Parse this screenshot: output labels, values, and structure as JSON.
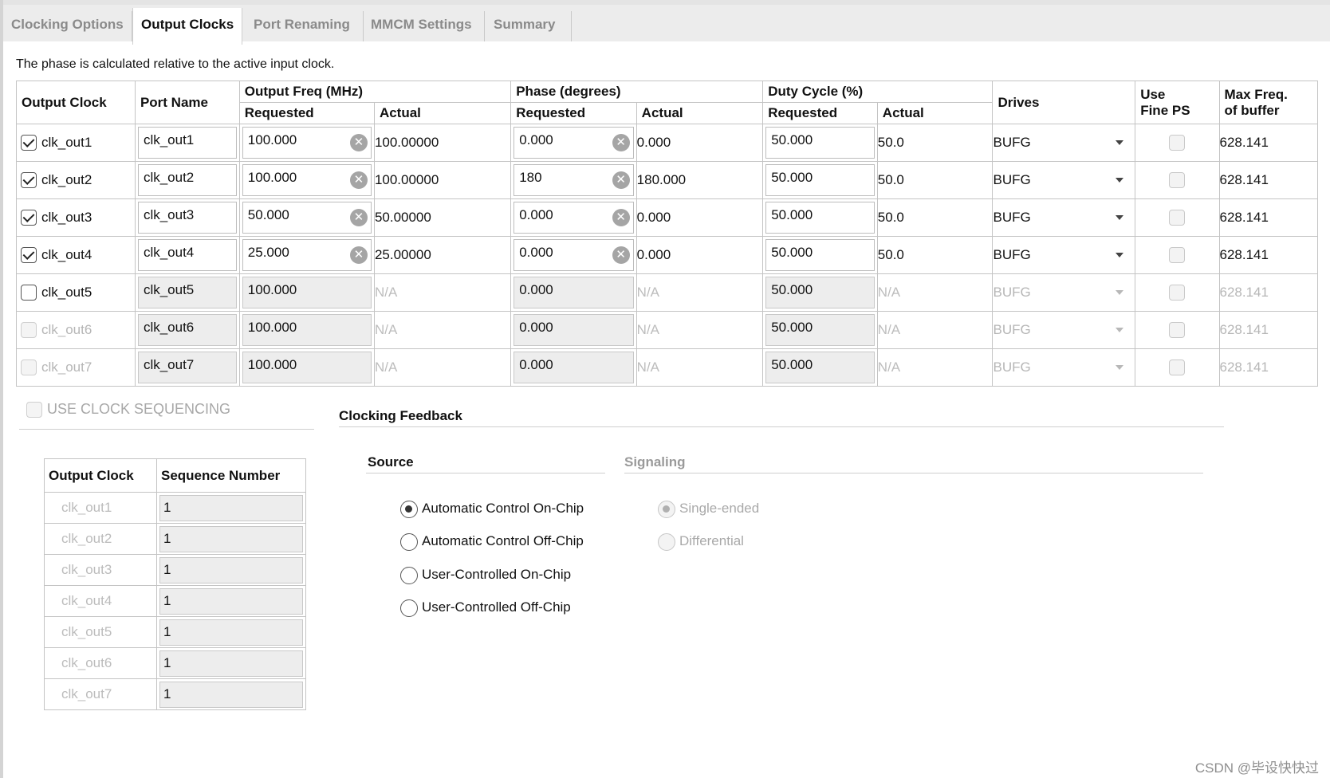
{
  "tabs": [
    "Clocking Options",
    "Output Clocks",
    "Port Renaming",
    "MMCM Settings",
    "Summary"
  ],
  "active_tab": "Output Clocks",
  "note": "The phase is calculated relative to the active input clock.",
  "table": {
    "headers": {
      "output_clock": "Output Clock",
      "port_name": "Port Name",
      "output_freq": "Output Freq (MHz)",
      "phase": "Phase (degrees)",
      "duty": "Duty Cycle (%)",
      "requested": "Requested",
      "actual": "Actual",
      "drives": "Drives",
      "use_fine_ps_1": "Use",
      "use_fine_ps_2": "Fine PS",
      "max_freq_1": "Max Freq.",
      "max_freq_2": "of buffer"
    },
    "rows": [
      {
        "clock": "clk_out1",
        "checked": true,
        "enabled": true,
        "port": "clk_out1",
        "freq_req": "100.000",
        "freq_act": "100.00000",
        "phase_req": "0.000",
        "phase_act": "0.000",
        "duty_req": "50.000",
        "duty_act": "50.0",
        "drives": "BUFG",
        "max_freq": "628.141"
      },
      {
        "clock": "clk_out2",
        "checked": true,
        "enabled": true,
        "port": "clk_out2",
        "freq_req": "100.000",
        "freq_act": "100.00000",
        "phase_req": "180",
        "phase_act": "180.000",
        "duty_req": "50.000",
        "duty_act": "50.0",
        "drives": "BUFG",
        "max_freq": "628.141"
      },
      {
        "clock": "clk_out3",
        "checked": true,
        "enabled": true,
        "port": "clk_out3",
        "freq_req": "50.000",
        "freq_act": "50.00000",
        "phase_req": "0.000",
        "phase_act": "0.000",
        "duty_req": "50.000",
        "duty_act": "50.0",
        "drives": "BUFG",
        "max_freq": "628.141"
      },
      {
        "clock": "clk_out4",
        "checked": true,
        "enabled": true,
        "port": "clk_out4",
        "freq_req": "25.000",
        "freq_act": "25.00000",
        "phase_req": "0.000",
        "phase_act": "0.000",
        "duty_req": "50.000",
        "duty_act": "50.0",
        "drives": "BUFG",
        "max_freq": "628.141"
      },
      {
        "clock": "clk_out5",
        "checked": false,
        "enabled": true,
        "port": "clk_out5",
        "freq_req": "100.000",
        "freq_act": "N/A",
        "phase_req": "0.000",
        "phase_act": "N/A",
        "duty_req": "50.000",
        "duty_act": "N/A",
        "drives": "BUFG",
        "max_freq": "628.141"
      },
      {
        "clock": "clk_out6",
        "checked": false,
        "enabled": false,
        "port": "clk_out6",
        "freq_req": "100.000",
        "freq_act": "N/A",
        "phase_req": "0.000",
        "phase_act": "N/A",
        "duty_req": "50.000",
        "duty_act": "N/A",
        "drives": "BUFG",
        "max_freq": "628.141"
      },
      {
        "clock": "clk_out7",
        "checked": false,
        "enabled": false,
        "port": "clk_out7",
        "freq_req": "100.000",
        "freq_act": "N/A",
        "phase_req": "0.000",
        "phase_act": "N/A",
        "duty_req": "50.000",
        "duty_act": "N/A",
        "drives": "BUFG",
        "max_freq": "628.141"
      }
    ]
  },
  "sequencing": {
    "checkbox_label": "USE CLOCK SEQUENCING",
    "headers": [
      "Output Clock",
      "Sequence Number"
    ],
    "rows": [
      {
        "clock": "clk_out1",
        "seq": "1"
      },
      {
        "clock": "clk_out2",
        "seq": "1"
      },
      {
        "clock": "clk_out3",
        "seq": "1"
      },
      {
        "clock": "clk_out4",
        "seq": "1"
      },
      {
        "clock": "clk_out5",
        "seq": "1"
      },
      {
        "clock": "clk_out6",
        "seq": "1"
      },
      {
        "clock": "clk_out7",
        "seq": "1"
      }
    ]
  },
  "feedback": {
    "title": "Clocking Feedback",
    "source_title": "Source",
    "signaling_title": "Signaling",
    "source_options": [
      "Automatic Control On-Chip",
      "Automatic Control Off-Chip",
      "User-Controlled On-Chip",
      "User-Controlled Off-Chip"
    ],
    "source_selected": 0,
    "signaling_options": [
      "Single-ended",
      "Differential"
    ],
    "signaling_selected": 0
  },
  "watermark": "CSDN @毕设快快过"
}
